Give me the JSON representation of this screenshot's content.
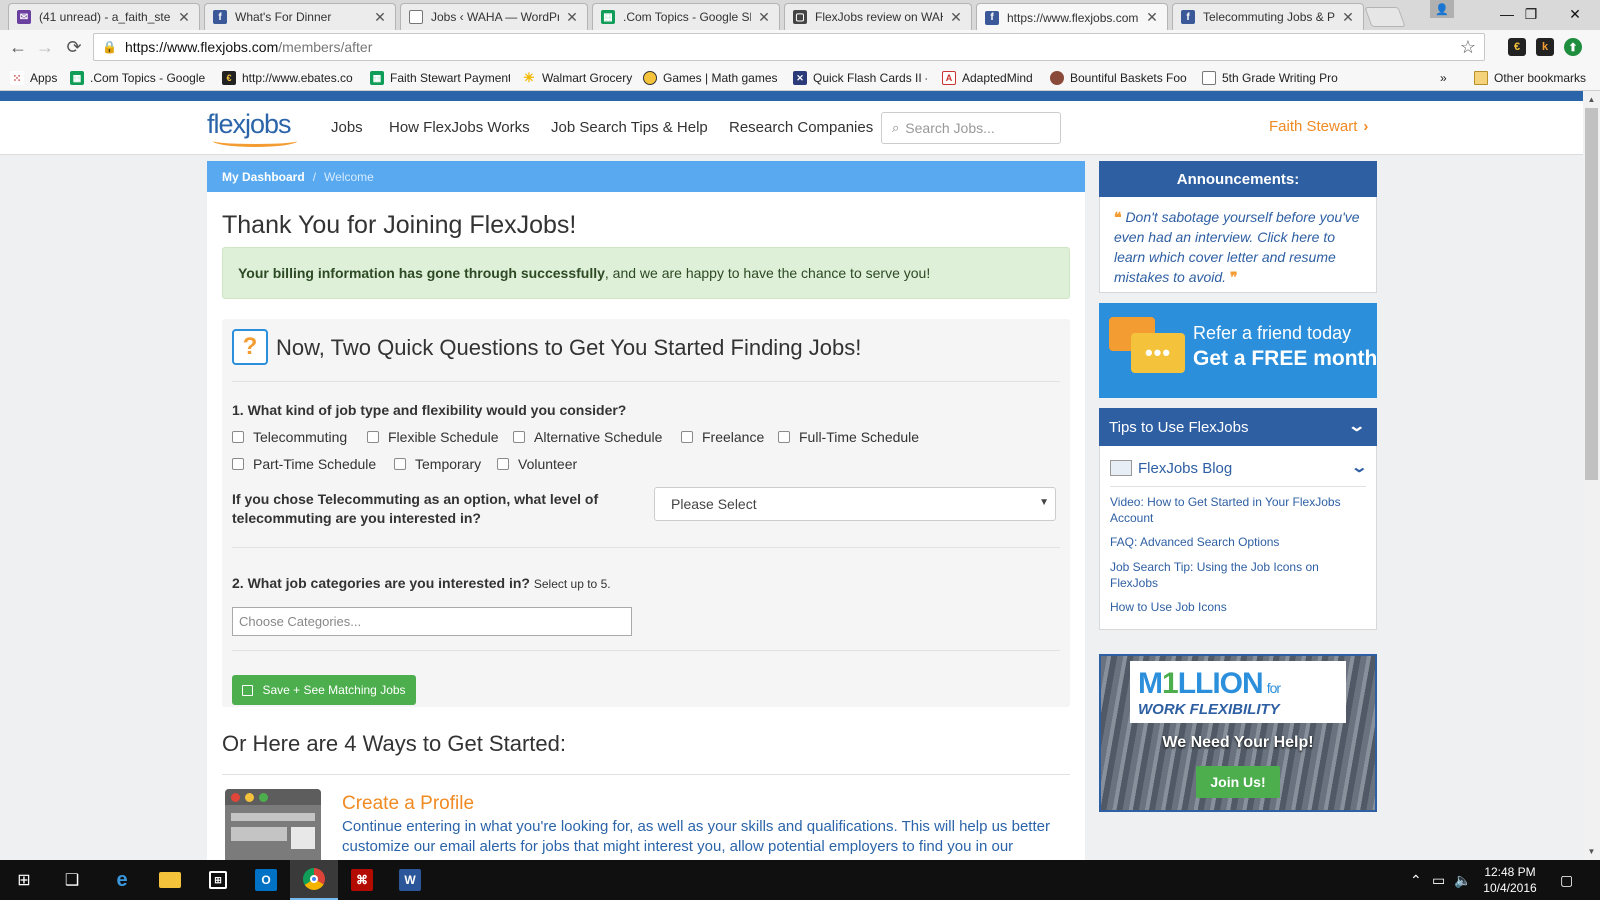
{
  "browser": {
    "tabs": [
      {
        "title": "(41 unread) - a_faith_ste",
        "icon": "mail-icon",
        "color": "#6b3fa0"
      },
      {
        "title": "What's For Dinner",
        "icon": "facebook-icon",
        "color": "#3b5998"
      },
      {
        "title": "Jobs ‹ WAHA — WordPre",
        "icon": "page-icon",
        "color": "#777777"
      },
      {
        "title": ".Com Topics - Google Sh",
        "icon": "sheets-icon",
        "color": "#0f9d58"
      },
      {
        "title": "FlexJobs review on WAH",
        "icon": "page-icon",
        "color": "#444444"
      },
      {
        "title": "https://www.flexjobs.com",
        "icon": "facebook-icon",
        "color": "#3b5998"
      },
      {
        "title": "Telecommuting Jobs & P",
        "icon": "facebook-icon",
        "color": "#3b5998"
      }
    ],
    "url_host": "https://www.flexjobs.com",
    "url_path": "/members/after",
    "bookmarks": [
      {
        "label": "Apps",
        "icon": "apps-grid-icon"
      },
      {
        "label": ".Com Topics - Google",
        "icon": "sheets-icon"
      },
      {
        "label": "http://www.ebates.co",
        "icon": "ebates-icon"
      },
      {
        "label": "Faith Stewart Payment",
        "icon": "sheets-icon"
      },
      {
        "label": "Walmart Grocery",
        "icon": "walmart-icon"
      },
      {
        "label": "Games | Math games",
        "icon": "games-icon"
      },
      {
        "label": "Quick Flash Cards II -",
        "icon": "flashcards-icon"
      },
      {
        "label": "AdaptedMind",
        "icon": "adaptedmind-icon"
      },
      {
        "label": "Bountiful Baskets Foo",
        "icon": "baskets-icon"
      },
      {
        "label": "5th Grade Writing Pro",
        "icon": "page-icon"
      }
    ],
    "overflow_label": "»",
    "other_bookmarks": "Other bookmarks"
  },
  "site": {
    "logo": "flexjobs",
    "nav": [
      "Jobs",
      "How FlexJobs Works",
      "Job Search Tips & Help",
      "Research Companies"
    ],
    "search_placeholder": "Search Jobs...",
    "user_name": "Faith Stewart",
    "user_chevron": "›"
  },
  "breadcrumb": {
    "home": "My Dashboard",
    "separator": "/",
    "current": "Welcome"
  },
  "main": {
    "title": "Thank You for Joining FlexJobs!",
    "alert_bold": "Your billing information has gone through successfully",
    "alert_rest": ", and we are happy to have the chance to serve you!",
    "questions_icon": "?",
    "questions_title": "Now, Two Quick Questions to Get You Started Finding Jobs!",
    "q1": "1. What kind of job type and flexibility would you consider?",
    "job_types": [
      "Telecommuting",
      "Flexible Schedule",
      "Alternative Schedule",
      "Freelance",
      "Full-Time Schedule",
      "Part-Time Schedule",
      "Temporary",
      "Volunteer"
    ],
    "telecommute_label": "If you chose Telecommuting as an option, what level of telecommuting are you interested in?",
    "telecommute_select": "Please Select",
    "q2": "2. What job categories are you interested in?",
    "q2_hint": "Select up to 5.",
    "categories_placeholder": "Choose Categories...",
    "save_button": "Save + See Matching Jobs",
    "ways_title": "Or Here are 4 Ways to Get Started:",
    "profile_title": "Create a Profile",
    "profile_desc": "Continue entering in what you're looking for, as well as your skills and qualifications. This will help us better customize our email alerts for jobs that might interest you, allow potential employers to find you in our"
  },
  "sidebar": {
    "announcements_title": "Announcements:",
    "announcement_open_quote": "❝",
    "announcement": "Don't sabotage yourself before you've even had an interview. Click here to learn which cover letter and resume mistakes to avoid.",
    "announcement_close_quote": "❞",
    "refer_line1": "Refer a friend today",
    "refer_line2": "Get a FREE month",
    "tips_title": "Tips to Use FlexJobs",
    "blog_label": "FlexJobs Blog",
    "tips": [
      "Video: How to Get Started in Your FlexJobs Account",
      "FAQ: Advanced Search Options",
      "Job Search Tip: Using the Job Icons on FlexJobs",
      "How to Use Job Icons"
    ],
    "million_m": "M",
    "million_one": "1",
    "million_llion": "LLION",
    "million_for": "for",
    "million_sub": "WORK FLEXIBILITY",
    "million_help": "We Need Your Help!",
    "million_join": "Join Us!"
  },
  "taskbar": {
    "time": "12:48 PM",
    "date": "10/4/2016"
  }
}
